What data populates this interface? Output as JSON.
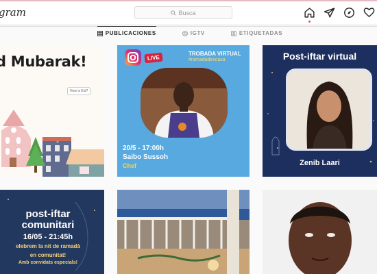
{
  "header": {
    "logo_text": "gram",
    "search_placeholder": "Busca"
  },
  "tabs": [
    {
      "label": "PUBLICACIONES",
      "icon": "grid-icon",
      "active": true
    },
    {
      "label": "IGTV",
      "icon": "igtv-icon",
      "active": false
    },
    {
      "label": "ETIQUETADAS",
      "icon": "tagged-icon",
      "active": false
    }
  ],
  "posts": {
    "p1": {
      "title": "d Mubarak!",
      "bubble": "How is Eid?"
    },
    "p2": {
      "live_badge": "LIVE",
      "header_title": "TROBADA VIRTUAL",
      "hashtag": "#ramadadescasa",
      "datetime": "20/5 - 17:00h",
      "name": "Saibo Sussoh",
      "role": "Chef"
    },
    "p3": {
      "title": "Post-iftar virtual",
      "name": "Zenib Laari"
    },
    "p4": {
      "line1": "post-iftar",
      "line1b": "comunitari",
      "datetime": "16/05 - 21:45h",
      "line3": "elebrem la nit de ramadà",
      "line3b": "en comunitat!",
      "line4": "Amb convidats especials!"
    }
  },
  "colors": {
    "accent_live": "#d6223d",
    "notification_dot": "#ed4956",
    "tile_blue": "#57a9e0",
    "tile_navy": "#1c2f5e"
  }
}
